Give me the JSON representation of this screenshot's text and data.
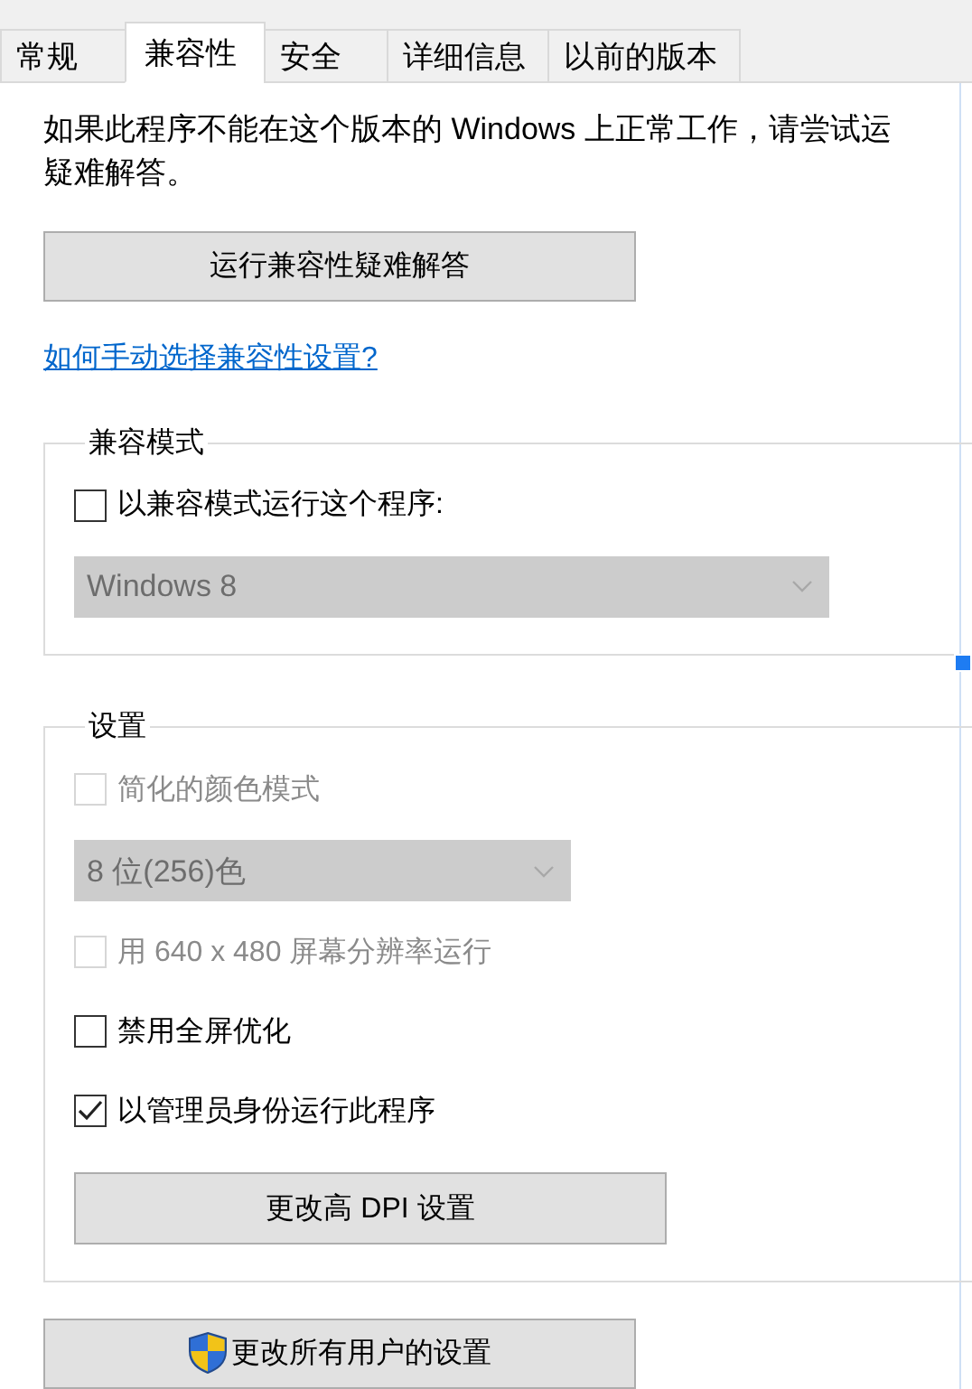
{
  "tabs": [
    {
      "label": "常规",
      "selected": false
    },
    {
      "label": "兼容性",
      "selected": true
    },
    {
      "label": "安全",
      "selected": false
    },
    {
      "label": "详细信息",
      "selected": false
    },
    {
      "label": "以前的版本",
      "selected": false
    }
  ],
  "intro": "如果此程序不能在这个版本的 Windows 上正常工作，请尝试运疑难解答。",
  "troubleshoot_button": "运行兼容性疑难解答",
  "help_link": "如何手动选择兼容性设置?",
  "compat_group": {
    "title": "兼容模式",
    "checkbox": {
      "label": "以兼容模式运行这个程序:",
      "checked": false,
      "disabled": false
    },
    "dropdown": {
      "value": "Windows 8",
      "disabled": true
    }
  },
  "settings_group": {
    "title": "设置",
    "items": [
      {
        "kind": "checkbox",
        "label": "简化的颜色模式",
        "checked": false,
        "disabled": true
      },
      {
        "kind": "dropdown",
        "value": "8 位(256)色",
        "disabled": true
      },
      {
        "kind": "checkbox",
        "label": "用 640 x 480 屏幕分辨率运行",
        "checked": false,
        "disabled": true
      },
      {
        "kind": "checkbox",
        "label": "禁用全屏优化",
        "checked": false,
        "disabled": false
      },
      {
        "kind": "checkbox",
        "label": "以管理员身份运行此程序",
        "checked": true,
        "disabled": false
      },
      {
        "kind": "button",
        "label": "更改高 DPI 设置"
      }
    ]
  },
  "all_users_button": "更改所有用户的设置"
}
